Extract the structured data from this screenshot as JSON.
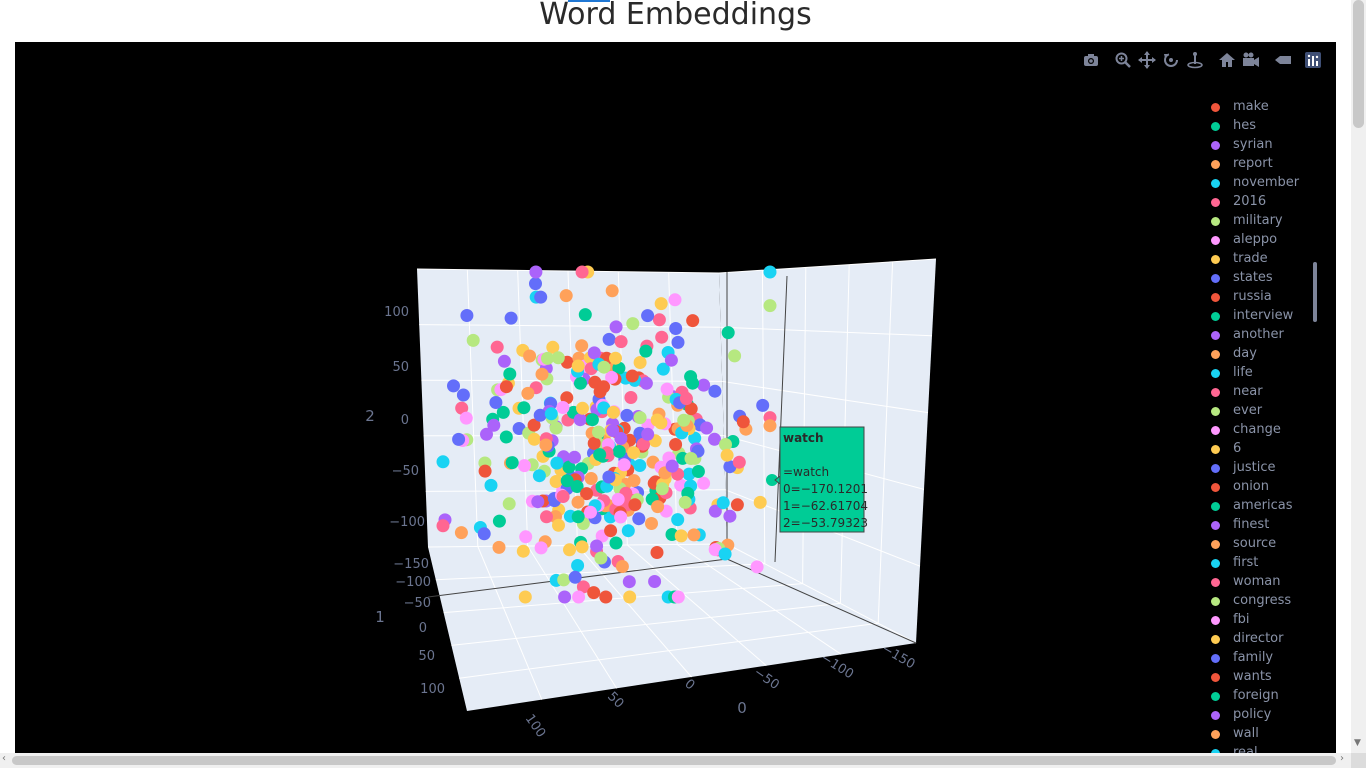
{
  "page": {
    "title": "Word Embeddings"
  },
  "modebar": {
    "buttons": [
      {
        "name": "camera-icon",
        "label": "Download plot as a png"
      },
      {
        "name": "zoom-icon",
        "label": "Zoom"
      },
      {
        "name": "pan-icon",
        "label": "Pan"
      },
      {
        "name": "orbit-rotation-icon",
        "label": "Orbital rotation"
      },
      {
        "name": "turntable-rotation-icon",
        "label": "Turntable rotation"
      },
      {
        "name": "home-icon",
        "label": "Reset camera to default"
      },
      {
        "name": "camera-view-icon",
        "label": "Reset camera to last save"
      },
      {
        "name": "hover-toggle-icon",
        "label": "Toggle show closest data on hover"
      },
      {
        "name": "plotly-logo-icon",
        "label": "Produced with Plotly"
      }
    ]
  },
  "colors": {
    "plot_bg": "#000000",
    "scene_bg": "#e5ecf6",
    "hover_bg": "#00cc96",
    "palette": [
      "#EF553B",
      "#00CC96",
      "#AB63FA",
      "#FFA15A",
      "#19D3F3",
      "#FF6692",
      "#B6E880",
      "#FF97FF",
      "#FECB52",
      "#636EFA"
    ]
  },
  "chart_data": {
    "type": "scatter3d",
    "title": "Word Embeddings",
    "axes": {
      "x": {
        "title": "0",
        "ticks": [
          "100",
          "50",
          "0",
          "−50",
          "−100",
          "−150"
        ],
        "range": [
          -170,
          120
        ]
      },
      "y": {
        "title": "1",
        "ticks": [
          "−150",
          "−100",
          "−50",
          "0",
          "50",
          "100"
        ],
        "range": [
          -160,
          110
        ]
      },
      "z": {
        "title": "2",
        "ticks": [
          "100",
          "50",
          "0",
          "−50",
          "−100"
        ],
        "range": [
          -140,
          130
        ]
      }
    },
    "legend_placement": "right",
    "series_names": [
      "make",
      "hes",
      "syrian",
      "report",
      "november",
      "2016",
      "military",
      "aleppo",
      "trade",
      "states",
      "russia",
      "interview",
      "another",
      "day",
      "life",
      "near",
      "ever",
      "change",
      "6",
      "justice",
      "onion",
      "americas",
      "finest",
      "source",
      "first",
      "woman",
      "congress",
      "fbi",
      "director",
      "family",
      "wants",
      "foreign",
      "policy",
      "wall",
      "real"
    ],
    "point_count": 400,
    "hover": {
      "title": "watch",
      "lines": [
        "=watch",
        "0=−170.1201",
        "1=−62.61704",
        "2=−53.79323"
      ],
      "x": -170.1201,
      "y": -62.61704,
      "z": -53.79323
    }
  }
}
